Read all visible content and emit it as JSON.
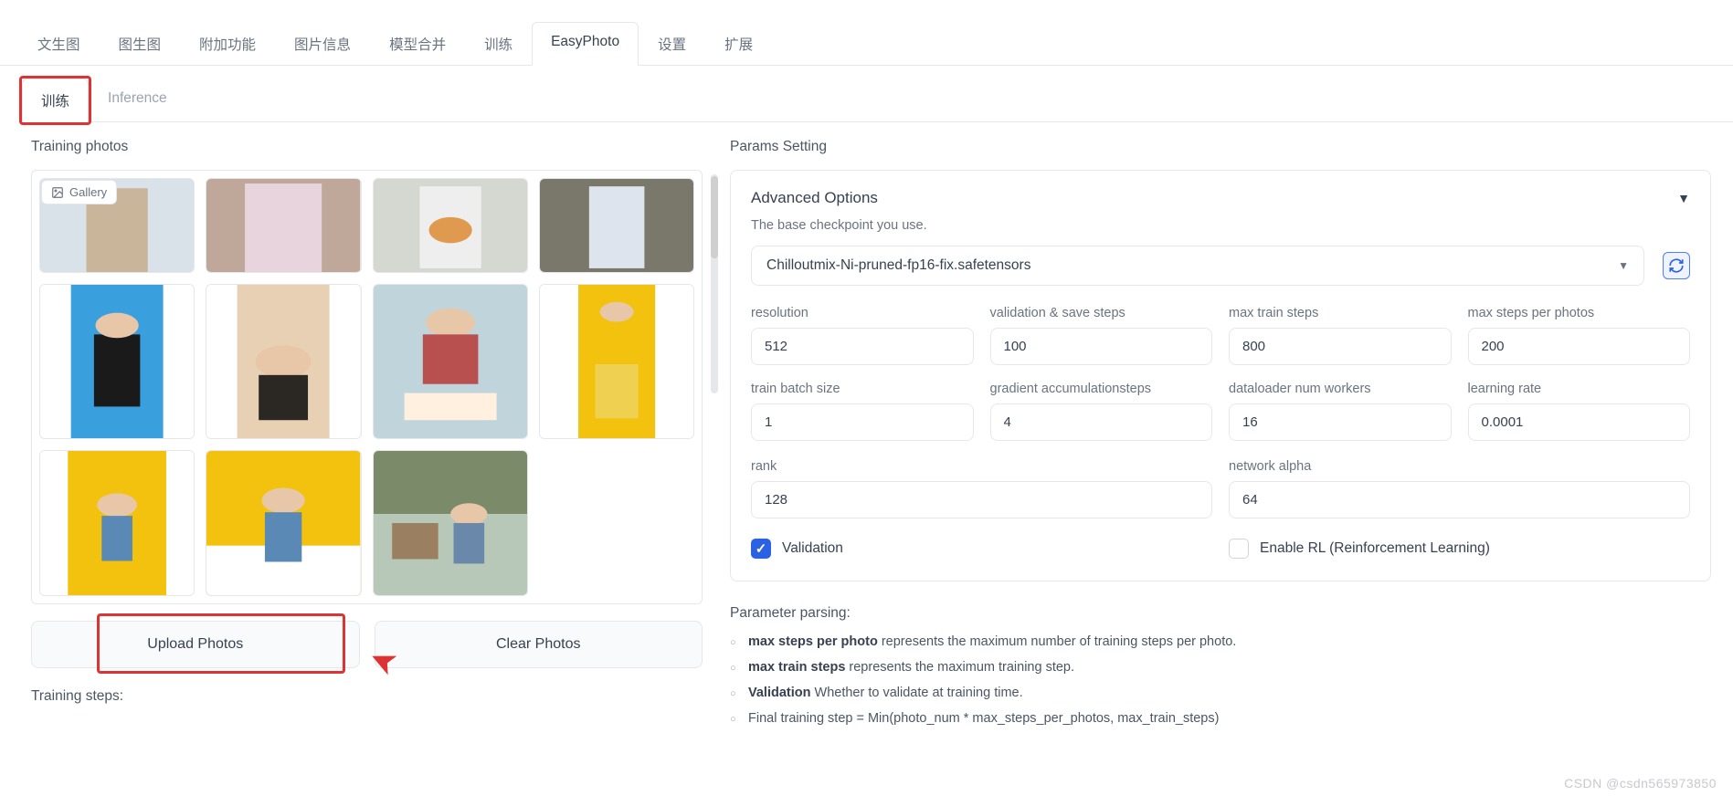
{
  "main_tabs": [
    "文生图",
    "图生图",
    "附加功能",
    "图片信息",
    "模型合并",
    "训练",
    "EasyPhoto",
    "设置",
    "扩展"
  ],
  "main_tab_active": 6,
  "sub_tabs": {
    "train": "训练",
    "inference": "Inference"
  },
  "left": {
    "title": "Training photos",
    "gallery_badge": "Gallery",
    "upload": "Upload Photos",
    "clear": "Clear Photos",
    "training_steps": "Training steps:"
  },
  "right": {
    "title": "Params Setting",
    "panel_title": "Advanced Options",
    "panel_sub": "The base checkpoint you use.",
    "checkpoint": "Chilloutmix-Ni-pruned-fp16-fix.safetensors",
    "fields": {
      "resolution": {
        "label": "resolution",
        "value": "512"
      },
      "val_steps": {
        "label": "validation & save steps",
        "value": "100"
      },
      "max_train": {
        "label": "max train steps",
        "value": "800"
      },
      "max_per_photo": {
        "label": "max steps per photos",
        "value": "200"
      },
      "batch": {
        "label": "train batch size",
        "value": "1"
      },
      "grad_acc": {
        "label": "gradient accumulationsteps",
        "value": "4"
      },
      "workers": {
        "label": "dataloader num workers",
        "value": "16"
      },
      "lr": {
        "label": "learning rate",
        "value": "0.0001"
      },
      "rank": {
        "label": "rank",
        "value": "128"
      },
      "net_alpha": {
        "label": "network alpha",
        "value": "64"
      }
    },
    "validation": "Validation",
    "enable_rl": "Enable RL (Reinforcement Learning)",
    "parse_title": "Parameter parsing:",
    "bullets": [
      {
        "b": "max steps per photo",
        "t": " represents the maximum number of training steps per photo."
      },
      {
        "b": "max train steps",
        "t": " represents the maximum training step."
      },
      {
        "b": "Validation",
        "t": " Whether to validate at training time."
      },
      {
        "b": "",
        "t": "Final training step = Min(photo_num * max_steps_per_photos, max_train_steps)"
      }
    ]
  },
  "watermark": "CSDN @csdn565973850"
}
